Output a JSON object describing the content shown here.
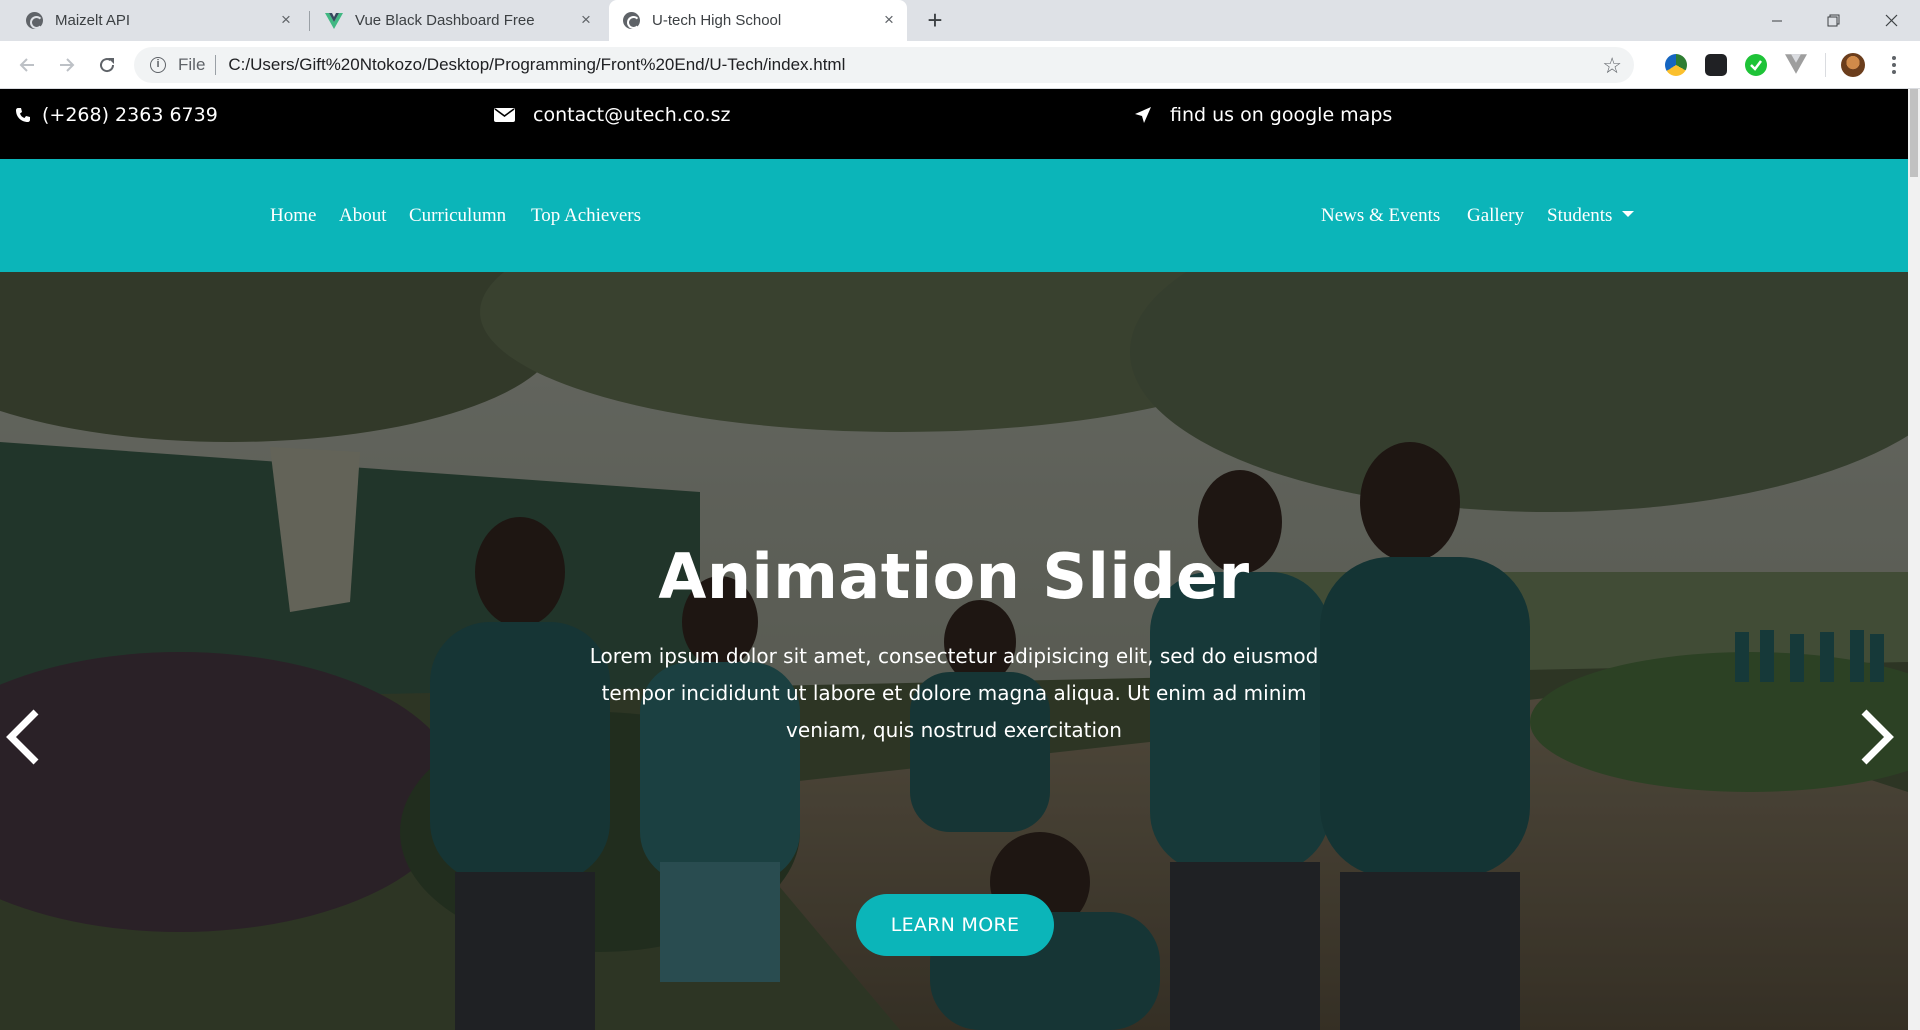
{
  "browser": {
    "tabs": [
      {
        "title": "Maizelt API",
        "icon": "globe-icon",
        "active": false
      },
      {
        "title": "Vue Black Dashboard Free",
        "icon": "vue-logo-icon",
        "active": false
      },
      {
        "title": "U-tech High School",
        "icon": "globe-icon",
        "active": true
      }
    ],
    "new_tab_label": "+",
    "omnibox": {
      "file_label": "File",
      "url": "C:/Users/Gift%20Ntokozo/Desktop/Programming/Front%20End/U-Tech/index.html"
    }
  },
  "contact_bar": {
    "phone": "(+268) 2363 6739",
    "email": "contact@utech.co.sz",
    "maps": "find us on google maps"
  },
  "navbar": {
    "left_links": [
      "Home",
      "About",
      "Curriculumn",
      "Top Achievers"
    ],
    "right_links": [
      "News & Events",
      "Gallery",
      "Students"
    ]
  },
  "hero": {
    "title": "Animation Slider",
    "text": "Lorem ipsum dolor sit amet, consectetur adipisicing elit, sed do eiusmod tempor incididunt ut labore et dolore magna aliqua. Ut enim ad minim veniam, quis nostrud exercitation",
    "button": "LEARN MORE"
  },
  "colors": {
    "accent": "#0bb5b9",
    "contact_bar": "#000000",
    "tabstrip": "#dee1e6"
  }
}
